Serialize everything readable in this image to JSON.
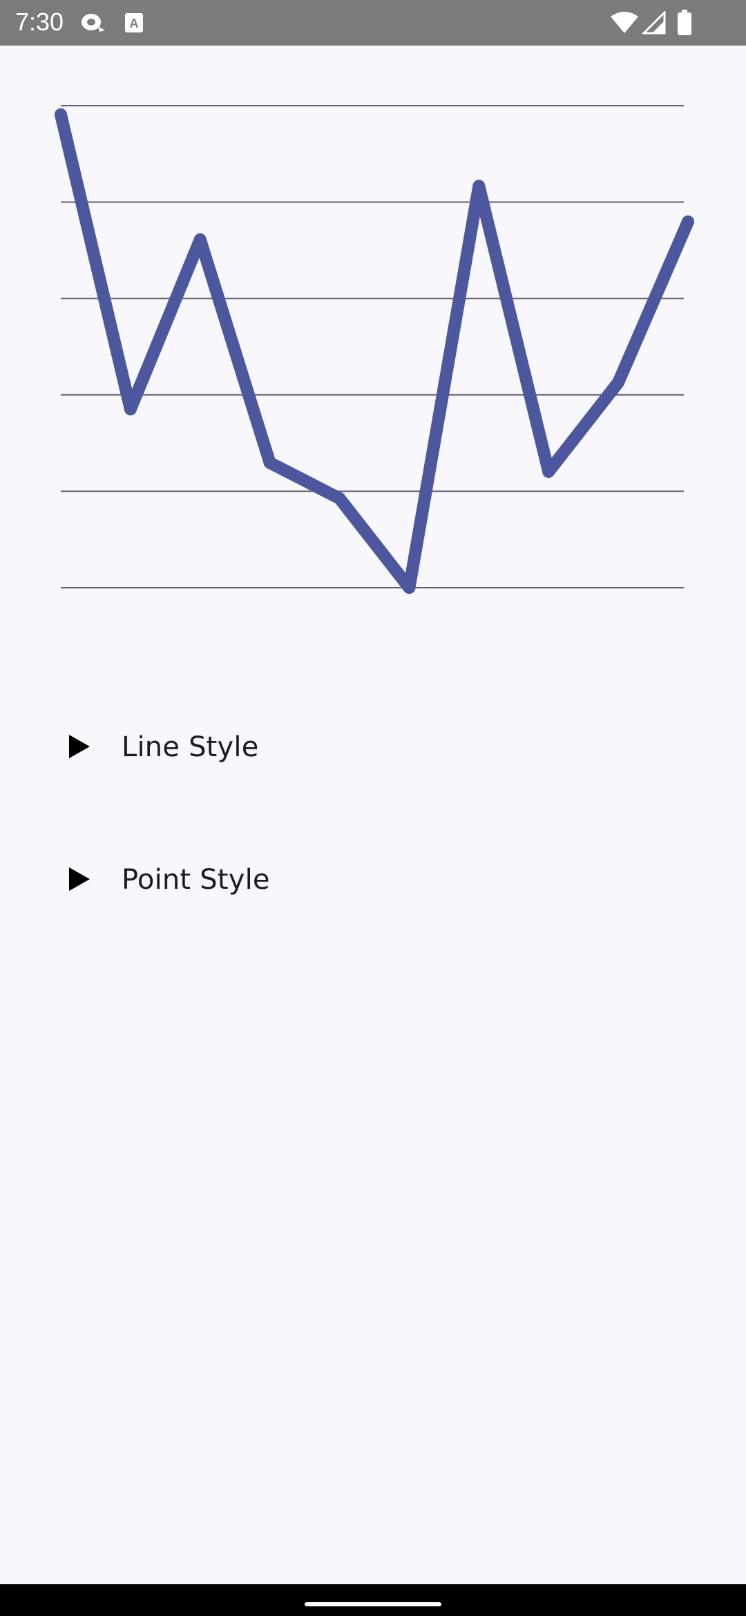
{
  "status_bar": {
    "time": "7:30",
    "icons": [
      "sync-icon",
      "text-a-icon",
      "wifi-icon",
      "signal-icon",
      "battery-icon"
    ],
    "background": "#7b7b7b"
  },
  "chart_data": {
    "type": "line",
    "x": [
      0,
      1,
      2,
      3,
      4,
      5,
      6,
      7,
      8,
      9
    ],
    "values": [
      102,
      69,
      88,
      63,
      59,
      49,
      94,
      62,
      72,
      90
    ],
    "ylim": [
      49,
      103
    ],
    "gridlines": 6,
    "grid": true,
    "title": "",
    "xlabel": "",
    "ylabel": "",
    "line_color": "#4d579e",
    "grid_color": "#5f5f70"
  },
  "sections": [
    {
      "label": "Line Style",
      "expanded": false
    },
    {
      "label": "Point Style",
      "expanded": false
    }
  ]
}
